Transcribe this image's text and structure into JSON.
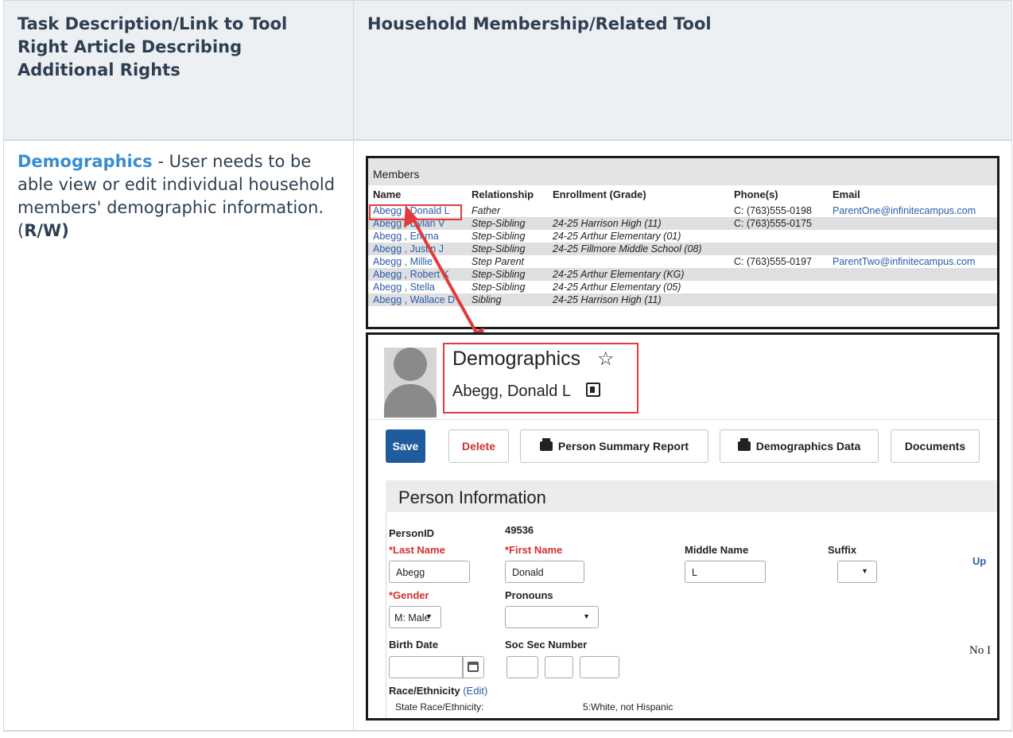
{
  "table": {
    "col1_header": "Task Description/Link to Tool Right Article Describing Additional Rights",
    "col2_header": "Household Membership/Related Tool",
    "row": {
      "link_text": "Demographics",
      "description": " - User needs to be able view or edit individual household members' demographic information. (",
      "rights": "R/W)"
    }
  },
  "members": {
    "title": "Members",
    "headers": {
      "name": "Name",
      "relationship": "Relationship",
      "enrollment": "Enrollment (Grade)",
      "phone": "Phone(s)",
      "email": "Email"
    },
    "rows": [
      {
        "name": "Abegg , Donald L",
        "relationship": "Father",
        "enrollment": "",
        "phone": "C:  (763)555-0198",
        "email": "ParentOne@infinitecampus.com"
      },
      {
        "name": "Abegg , Dylan V",
        "relationship": "Step-Sibling",
        "enrollment": "24-25 Harrison High (11)",
        "phone": "C:  (763)555-0175",
        "email": ""
      },
      {
        "name": "Abegg , Emma",
        "relationship": "Step-Sibling",
        "enrollment": "24-25 Arthur Elementary (01)",
        "phone": "",
        "email": ""
      },
      {
        "name": "Abegg , Justin J",
        "relationship": "Step-Sibling",
        "enrollment": "24-25 Fillmore Middle School (08)",
        "phone": "",
        "email": ""
      },
      {
        "name": "Abegg , Millie",
        "relationship": "Step Parent",
        "enrollment": "",
        "phone": "C:  (763)555-0197",
        "email": "ParentTwo@infinitecampus.com"
      },
      {
        "name": "Abegg , Robert K",
        "relationship": "Step-Sibling",
        "enrollment": "24-25 Arthur Elementary (KG)",
        "phone": "",
        "email": ""
      },
      {
        "name": "Abegg , Stella",
        "relationship": "Step-Sibling",
        "enrollment": "24-25 Arthur Elementary (05)",
        "phone": "",
        "email": ""
      },
      {
        "name": "Abegg , Wallace D",
        "relationship": "Sibling",
        "enrollment": "24-25 Harrison High (11)",
        "phone": "",
        "email": ""
      }
    ]
  },
  "demographics": {
    "title": "Demographics",
    "star": "☆",
    "person_name": "Abegg, Donald L",
    "buttons": {
      "save": "Save",
      "delete": "Delete",
      "summary": "Person Summary Report",
      "data": "Demographics Data",
      "documents": "Documents"
    },
    "section_title": "Person Information",
    "fields": {
      "person_id_label": "PersonID",
      "person_id_value": "49536",
      "last_name_label": "*Last Name",
      "last_name_value": "Abegg",
      "first_name_label": "*First Name",
      "first_name_value": "Donald",
      "middle_name_label": "Middle Name",
      "middle_name_value": "L",
      "suffix_label": "Suffix",
      "upload_link": "Up",
      "gender_label": "*Gender",
      "gender_value": "M: Male",
      "pronouns_label": "Pronouns",
      "birth_date_label": "Birth Date",
      "ssn_label": "Soc Sec Number",
      "no_text": "No I",
      "race_label": "Race/Ethnicity",
      "race_edit": "(Edit)",
      "state_race_label": "State Race/Ethnicity:",
      "state_race_value": "5:White, not Hispanic"
    },
    "colors": {
      "required": "#d32f2f",
      "save_bg": "#1f5c9e",
      "link": "#2b5ca8",
      "annotation": "#e23b3b"
    }
  }
}
